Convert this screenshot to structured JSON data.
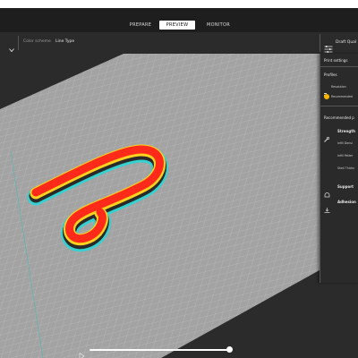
{
  "tabs": {
    "prepare": "PREPARE",
    "preview": "PREVIEW",
    "monitor": "MONITOR"
  },
  "toolbar": {
    "color_scheme_label": "Color scheme",
    "color_scheme_value": "Line Type",
    "profile_button": "Draft Qual"
  },
  "print_settings": {
    "title": "Print settings",
    "profiles_label": "Profiles",
    "resolution_label": "Resolution",
    "recommended_label": "Recommended",
    "recommended_section": "Recommended p",
    "strength_label": "Strength",
    "infill_density": "Infill Densi",
    "infill_pattern": "Infill Patter",
    "shell_thickness": "Shell Thickn",
    "support_label": "Support",
    "adhesion_label": "Adhesion"
  },
  "colors": {
    "model": "#ff2a1a",
    "outer_wall": "#ffd21f",
    "skirt": "#29d6d6",
    "bed": "#a3a3a3",
    "background": "#2b2b2b"
  },
  "slider": {
    "position_fraction": 0.99
  }
}
